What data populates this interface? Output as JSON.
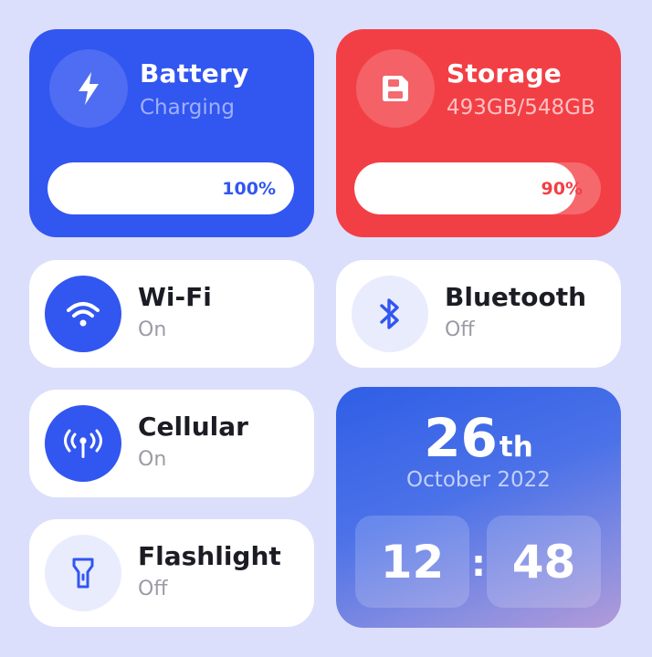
{
  "battery": {
    "title": "Battery",
    "status": "Charging",
    "percent_label": "100%",
    "level": 1.0,
    "icon": "lightning-bolt-icon"
  },
  "storage": {
    "title": "Storage",
    "usage": "493GB/548GB",
    "percent_label": "90%",
    "level": 0.9,
    "icon": "floppy-disk-icon"
  },
  "wifi": {
    "title": "Wi-Fi",
    "state": "On",
    "icon": "wifi-icon"
  },
  "bluetooth": {
    "title": "Bluetooth",
    "state": "Off",
    "icon": "bluetooth-icon"
  },
  "cellular": {
    "title": "Cellular",
    "state": "On",
    "icon": "cellular-antenna-icon"
  },
  "flashlight": {
    "title": "Flashlight",
    "state": "Off",
    "icon": "flashlight-icon"
  },
  "datetime": {
    "day": "26",
    "day_suffix": "th",
    "month_year": "October 2022",
    "hour": "12",
    "separator": ":",
    "minute": "48"
  },
  "colors": {
    "background": "#dcdffb",
    "accent_blue": "#3256f0",
    "accent_red": "#f23f45",
    "tile_white": "#ffffff",
    "text_dark": "#1c1c24",
    "text_muted": "#9b9ba5"
  }
}
